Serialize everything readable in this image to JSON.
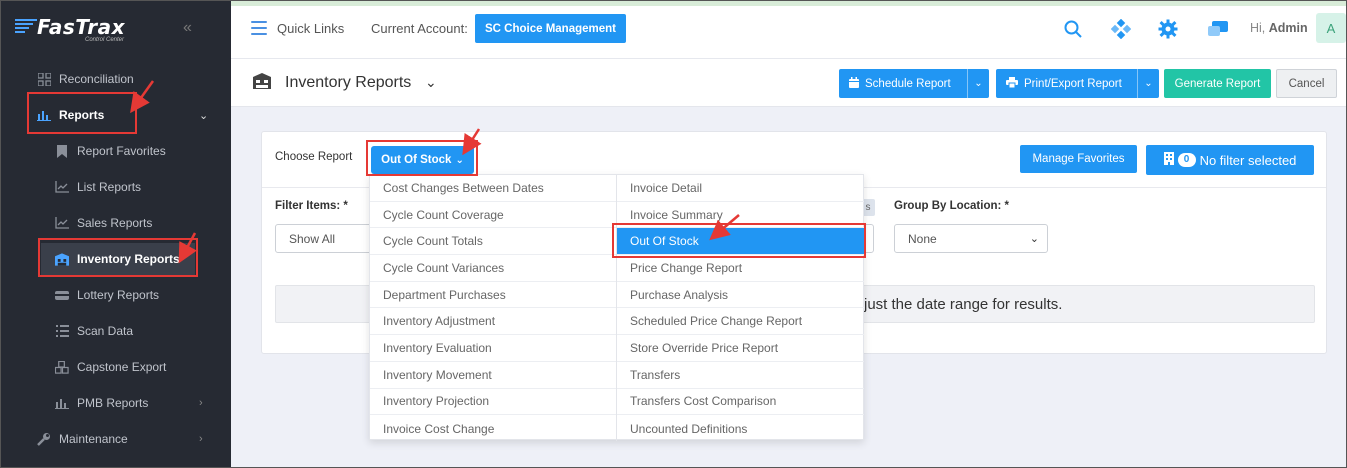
{
  "brand": {
    "name": "FasTrax",
    "tagline": "Control Center"
  },
  "sidebar": {
    "items": [
      {
        "label": "Reconciliation",
        "level": "top",
        "icon": "grid-icon"
      },
      {
        "label": "Reports",
        "level": "top",
        "icon": "bar-chart-icon",
        "expanded": true
      },
      {
        "label": "Report Favorites",
        "level": "sub",
        "icon": "bookmark-icon"
      },
      {
        "label": "List Reports",
        "level": "sub",
        "icon": "line-chart-icon"
      },
      {
        "label": "Sales Reports",
        "level": "sub",
        "icon": "line-chart-icon"
      },
      {
        "label": "Inventory Reports",
        "level": "sub",
        "icon": "warehouse-icon",
        "active": true
      },
      {
        "label": "Lottery Reports",
        "level": "sub",
        "icon": "ticket-icon"
      },
      {
        "label": "Scan Data",
        "level": "sub",
        "icon": "list-icon"
      },
      {
        "label": "Capstone Export",
        "level": "sub",
        "icon": "cubes-icon"
      },
      {
        "label": "PMB Reports",
        "level": "sub",
        "icon": "bar-chart-icon"
      },
      {
        "label": "Maintenance",
        "level": "top",
        "icon": "wrench-icon"
      }
    ]
  },
  "topbar": {
    "quick_links": "Quick Links",
    "current_account_label": "Current Account:",
    "current_account": "SC Choice Management",
    "greeting": "Hi,",
    "user": "Admin",
    "avatar_initial": "A"
  },
  "page": {
    "title": "Inventory Reports",
    "buttons": {
      "schedule": "Schedule Report",
      "print_export": "Print/Export Report",
      "generate": "Generate Report",
      "cancel": "Cancel"
    }
  },
  "report": {
    "choose_label": "Choose Report",
    "selected": "Out Of Stock",
    "manage_favorites": "Manage Favorites",
    "filter_count": "0",
    "filter_text": "No filter selected",
    "filter_items_label": "Filter Items: *",
    "filter_items_value": "Show All",
    "group_by_label": "Group By Location: *",
    "group_by_value": "None",
    "info_message": "just the date range for results."
  },
  "dropdown": {
    "left": [
      "Cost Changes Between Dates",
      "Cycle Count Coverage",
      "Cycle Count Totals",
      "Cycle Count Variances",
      "Department Purchases",
      "Inventory Adjustment",
      "Inventory Evaluation",
      "Inventory Movement",
      "Inventory Projection",
      "Invoice Cost Change"
    ],
    "right": [
      "Invoice Detail",
      "Invoice Summary",
      "Out Of Stock",
      "Price Change Report",
      "Purchase Analysis",
      "Scheduled Price Change Report",
      "Store Override Price Report",
      "Transfers",
      "Transfers Cost Comparison",
      "Uncounted Definitions"
    ],
    "highlighted": "Out Of Stock"
  },
  "colors": {
    "primary": "#2196f3",
    "teal": "#22c5a6",
    "annotation": "#e53935",
    "sidebar": "#262a33"
  }
}
